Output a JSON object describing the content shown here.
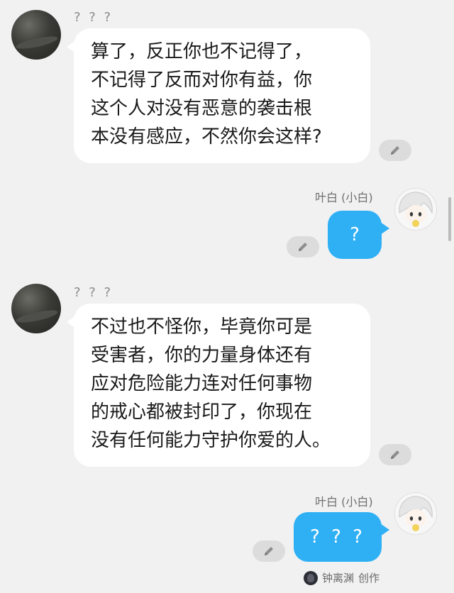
{
  "messages": [
    {
      "sender": "? ? ?",
      "side": "left",
      "lines": [
        "算了，反正你也不记得了，",
        "不记得了反而对你有益，你",
        "这个人对没有恶意的袭击根",
        "本没有感应，不然你会这样?"
      ]
    },
    {
      "sender": "叶白 (小白)",
      "side": "right",
      "text": "?"
    },
    {
      "sender": "? ? ?",
      "side": "left",
      "lines": [
        "不过也不怪你，毕竟你可是",
        "受害者，你的力量身体还有",
        "应对危险能力连对任何事物",
        "的戒心都被封印了，你现在",
        "没有任何能力守护你爱的人。"
      ]
    },
    {
      "sender": "叶白 (小白)",
      "side": "right",
      "text": "? ? ?"
    }
  ],
  "footer": {
    "author": "钟离渊",
    "action": "创作"
  },
  "icons": {
    "edit": "pencil-icon",
    "left_avatar": "dark-avatar-icon",
    "right_avatar": "anime-boy-avatar-icon"
  },
  "colors": {
    "background": "#f1f1f2",
    "reply_bubble": "#2fb0f5",
    "incoming_bubble": "#ffffff"
  }
}
